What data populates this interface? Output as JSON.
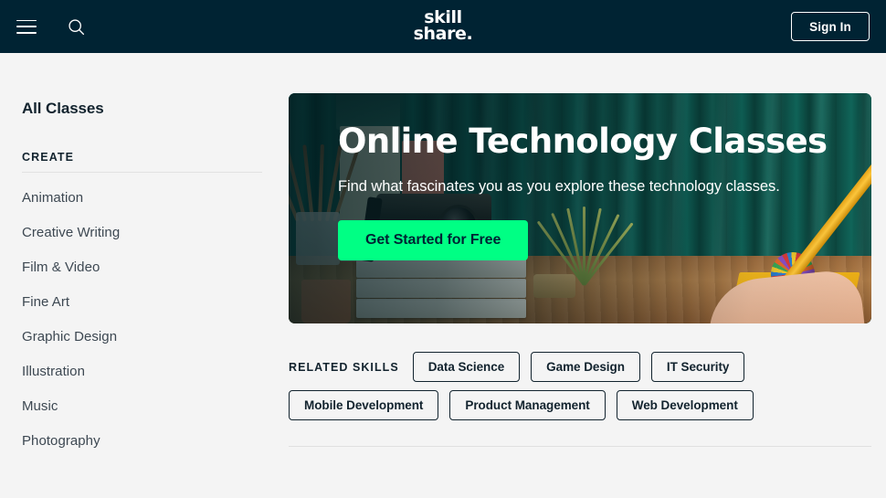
{
  "header": {
    "menu_icon": "hamburger-menu-icon",
    "search_icon": "search-icon",
    "logo_line1": "skill",
    "logo_line2": "share.",
    "signin_label": "Sign In",
    "background_color": "#002333"
  },
  "sidebar": {
    "all_classes_label": "All Classes",
    "section_label": "CREATE",
    "categories": [
      {
        "label": "Animation"
      },
      {
        "label": "Creative Writing"
      },
      {
        "label": "Film & Video"
      },
      {
        "label": "Fine Art"
      },
      {
        "label": "Graphic Design"
      },
      {
        "label": "Illustration"
      },
      {
        "label": "Music"
      },
      {
        "label": "Photography"
      }
    ]
  },
  "hero": {
    "title": "Online Technology Classes",
    "subtitle": "Find what fascinates you as you explore these technology classes.",
    "cta_label": "Get Started for Free",
    "cta_color": "#00ff84",
    "cta_text_color": "#002333"
  },
  "related_skills": {
    "label": "RELATED SKILLS",
    "pills_row1": [
      {
        "label": "Data Science"
      },
      {
        "label": "Game Design"
      },
      {
        "label": "IT Security"
      }
    ],
    "pills_row2": [
      {
        "label": "Mobile Development"
      },
      {
        "label": "Product Management"
      },
      {
        "label": "Web Development"
      }
    ]
  },
  "theme": {
    "page_background": "#f4f4f4",
    "ink": "#12232e",
    "muted_text": "#3d4852",
    "divider": "#e0e0e0"
  }
}
